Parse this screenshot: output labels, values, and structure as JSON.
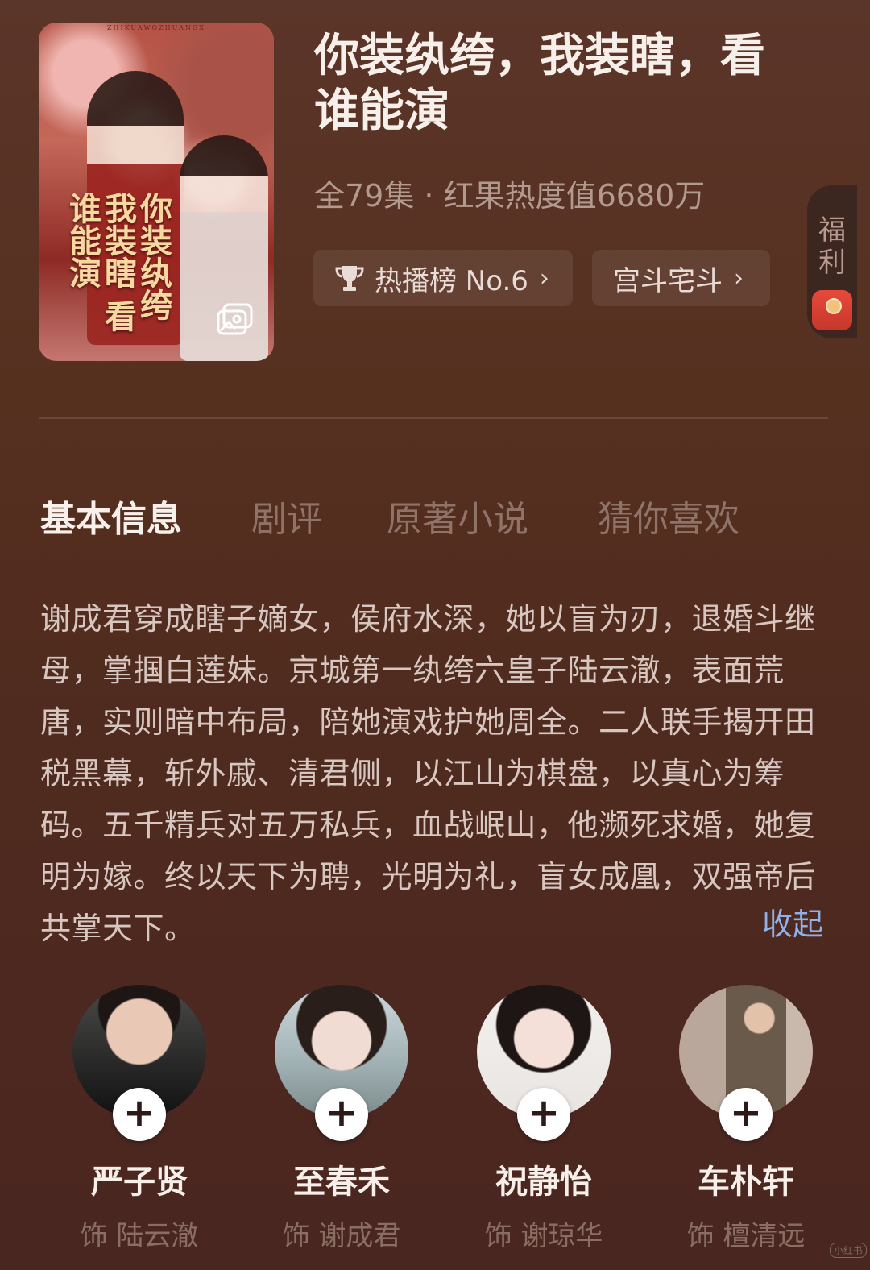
{
  "poster": {
    "top_text": "ZHIKUAWOZHUANGX",
    "title": "你装纨绔 我装瞎 看谁能演",
    "icon": "photo-gallery-icon"
  },
  "drama": {
    "title": "你装纨绔，我装瞎，看谁能演",
    "meta": "全79集 · 红果热度值6680万"
  },
  "chips": [
    {
      "icon": "trophy-icon",
      "label": "热播榜 No.6",
      "chevron": "›"
    },
    {
      "label": "宫斗宅斗",
      "chevron": "›"
    }
  ],
  "welfare": {
    "label": "福利",
    "icon": "red-envelope-icon"
  },
  "tabs": [
    "基本信息",
    "剧评",
    "原著小说",
    "猜你喜欢"
  ],
  "description": "谢成君穿成瞎子嫡女，侯府水深，她以盲为刃，退婚斗继母，掌掴白莲妹。京城第一纨绔六皇子陆云澈，表面荒唐，实则暗中布局，陪她演戏护她周全。二人联手揭开田税黑幕，斩外戚、清君侧，以江山为棋盘，以真心为筹码。五千精兵对五万私兵，血战岷山，他濒死求婚，她复明为嫁。终以天下为聘，光明为礼，盲女成凰，双强帝后共掌天下。",
  "collapse_label": "收起",
  "cast": [
    {
      "name": "严子贤",
      "role": "饰 陆云澈"
    },
    {
      "name": "至春禾",
      "role": "饰 谢成君"
    },
    {
      "name": "祝静怡",
      "role": "饰 谢琼华"
    },
    {
      "name": "车朴轩",
      "role": "饰 檀清远"
    }
  ],
  "plus_symbol": "+",
  "watermark": "小红书"
}
